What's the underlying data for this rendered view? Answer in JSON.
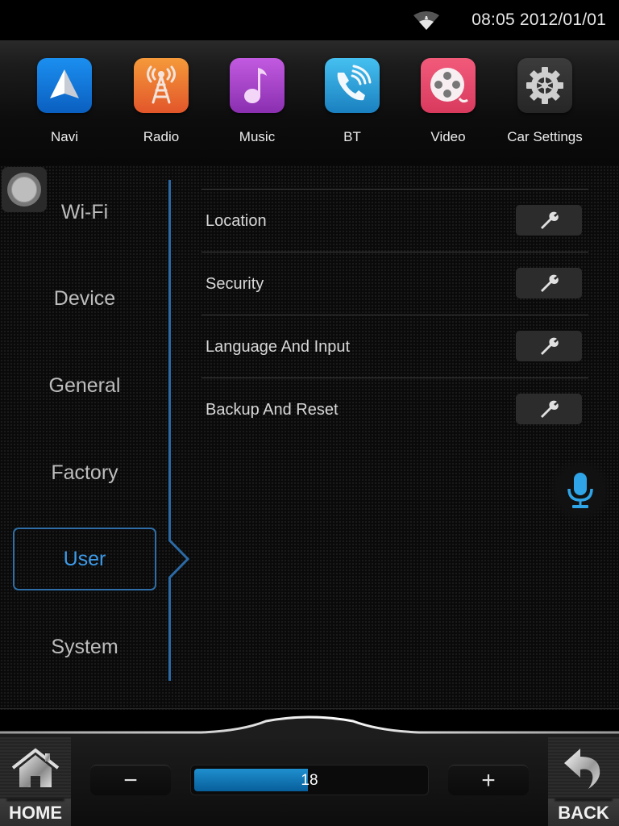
{
  "status_bar": {
    "wifi_icon": "wifi-signal-icon",
    "time": "08:05",
    "date": "2012/01/01",
    "clock_text": "08:05 2012/01/01"
  },
  "dock": {
    "apps": [
      {
        "label": "Navi",
        "icon": "navigation-arrow-icon",
        "color": "#1a7fe0"
      },
      {
        "label": "Radio",
        "icon": "radio-tower-icon",
        "color": "#f07a28"
      },
      {
        "label": "Music",
        "icon": "music-note-icon",
        "color": "#a545cc"
      },
      {
        "label": "BT",
        "icon": "bluetooth-phone-icon",
        "color": "#2aa3dc"
      },
      {
        "label": "Video",
        "icon": "film-reel-icon",
        "color": "#e8456a"
      },
      {
        "label": "Car Settings",
        "icon": "gear-icon",
        "color": "#333333"
      }
    ]
  },
  "sidebar": {
    "items": [
      {
        "label": "Wi-Fi",
        "active": false
      },
      {
        "label": "Device",
        "active": false
      },
      {
        "label": "General",
        "active": false
      },
      {
        "label": "Factory",
        "active": false
      },
      {
        "label": "User",
        "active": true
      },
      {
        "label": "System",
        "active": false
      }
    ],
    "accent_color": "#3d9be9"
  },
  "settings": {
    "rows": [
      {
        "label": "Location",
        "action_icon": "wrench-icon"
      },
      {
        "label": "Security",
        "action_icon": "wrench-icon"
      },
      {
        "label": "Language And Input",
        "action_icon": "wrench-icon"
      },
      {
        "label": "Backup And Reset",
        "action_icon": "wrench-icon"
      }
    ]
  },
  "voice": {
    "icon": "microphone-icon",
    "color": "#2fa4e7"
  },
  "bottom_bar": {
    "home_label": "HOME",
    "back_label": "BACK",
    "volume": {
      "minus_label": "−",
      "plus_label": "+",
      "value": "18",
      "fill_fraction": 0.49
    }
  }
}
